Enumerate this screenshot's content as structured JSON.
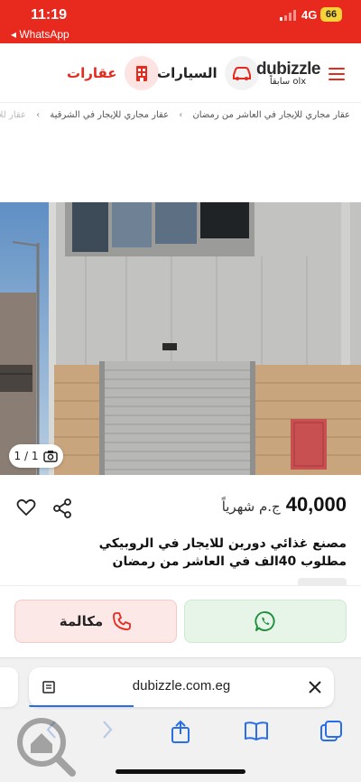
{
  "status": {
    "time": "11:19",
    "back_app": "◂ WhatsApp",
    "network": "4G",
    "battery": "66"
  },
  "header": {
    "logo": "dubizzle",
    "logo_sub": "سابقاً olx",
    "categories": [
      {
        "label": "عقارات",
        "icon": "building-icon",
        "selected": true
      },
      {
        "label": "السيارات",
        "icon": "car-icon",
        "selected": false
      }
    ],
    "brand_color": "#e8291d"
  },
  "breadcrumb": {
    "items": [
      "عقار مجاري للإيجار في العاشر من رمضان",
      "عقار مجاري للإيجار في الشرقية",
      "عقار للإيجار"
    ]
  },
  "listing": {
    "photo_counter": "1 / 1",
    "price_amount": "40,000",
    "price_unit": "ج.م شهرياً",
    "title_line1": "مصنع غذائي دورين للايجار في الروبيكي",
    "title_line2": "مطلوب 40الف في العاشر من رمضان"
  },
  "actions": {
    "call_label": "مكالمة",
    "whatsapp_icon": "whatsapp-icon",
    "call_color": "#fde8e8",
    "whatsapp_color": "#e7f5e8"
  },
  "browser": {
    "url": "dubizzle.com.eg"
  }
}
